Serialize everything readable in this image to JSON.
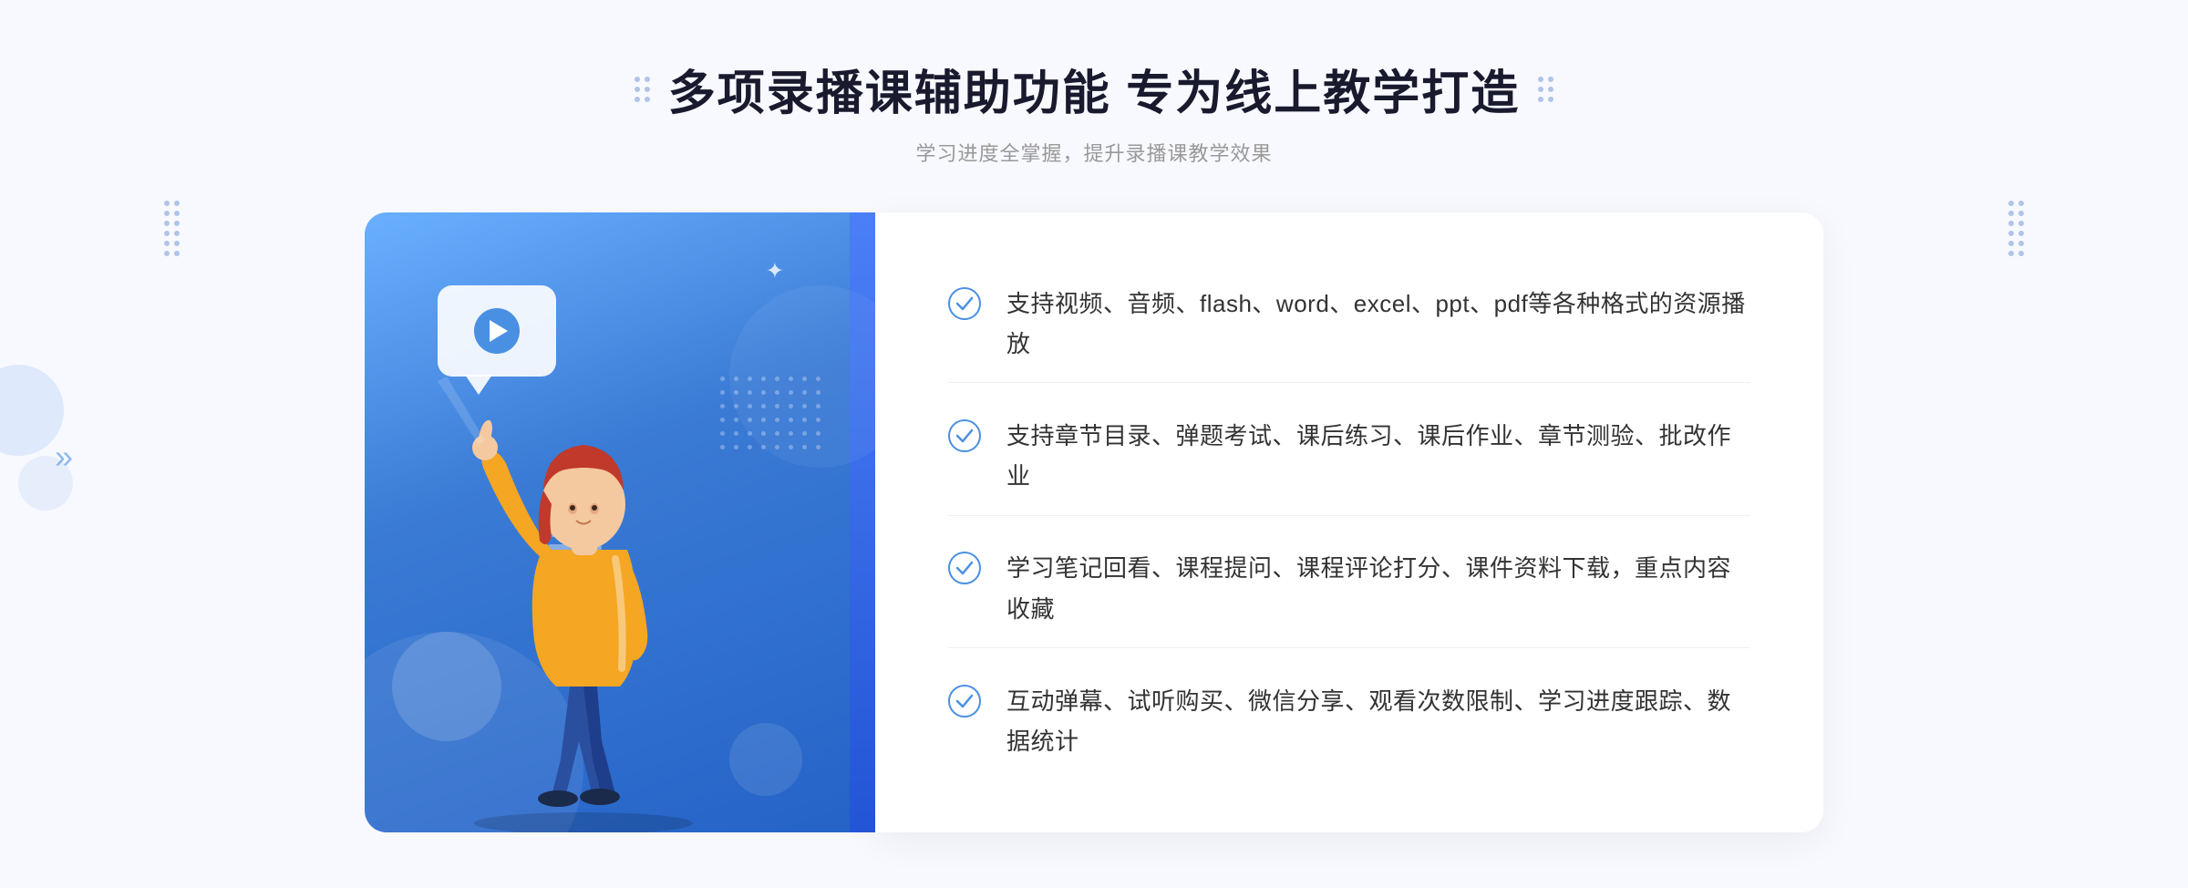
{
  "header": {
    "main_title": "多项录播课辅助功能 专为线上教学打造",
    "subtitle": "学习进度全掌握，提升录播课教学效果"
  },
  "features": [
    {
      "id": 1,
      "text": "支持视频、音频、flash、word、excel、ppt、pdf等各种格式的资源播放"
    },
    {
      "id": 2,
      "text": "支持章节目录、弹题考试、课后练习、课后作业、章节测验、批改作业"
    },
    {
      "id": 3,
      "text": "学习笔记回看、课程提问、课程评论打分、课件资料下载，重点内容收藏"
    },
    {
      "id": 4,
      "text": "互动弹幕、试听购买、微信分享、观看次数限制、学习进度跟踪、数据统计"
    }
  ],
  "colors": {
    "accent_blue": "#4a90e2",
    "dark_blue": "#2563c7",
    "text_dark": "#333333",
    "text_gray": "#999999",
    "bg_light": "#f8f9ff"
  }
}
